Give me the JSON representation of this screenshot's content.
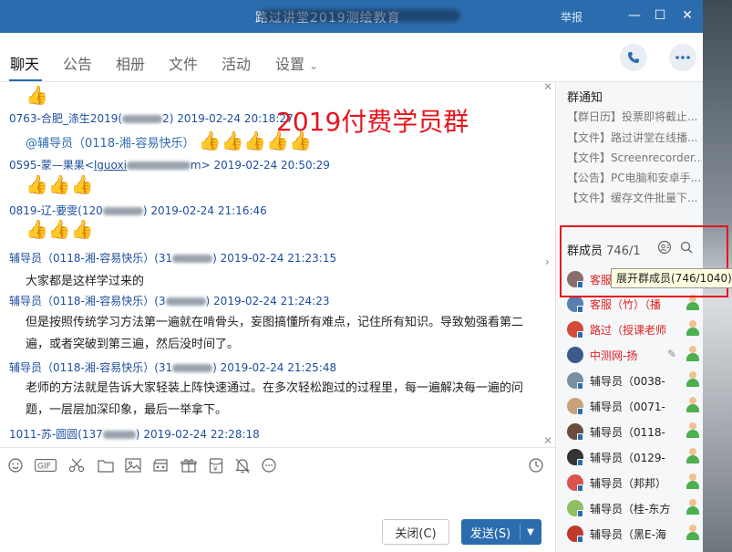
{
  "window": {
    "title": "路过讲堂2019测绘教育",
    "report_label": "举报",
    "minimize_glyph": "—",
    "maximize_glyph": "☐",
    "close_glyph": "✕"
  },
  "tabs": [
    {
      "label": "聊天",
      "active": true
    },
    {
      "label": "公告",
      "active": false
    },
    {
      "label": "相册",
      "active": false
    },
    {
      "label": "文件",
      "active": false
    },
    {
      "label": "活动",
      "active": false
    },
    {
      "label": "设置",
      "active": false
    }
  ],
  "settings_caret": "⌄",
  "messages": [
    {
      "thumbs": "👍"
    },
    {
      "sender": "0763-合肥_涤生2019(",
      "qq_tail": "2)",
      "time": "2019-02-24 20:18:27"
    },
    {
      "mention": "@辅导员（0118-湘-容易快乐）",
      "thumbs": "👍👍👍👍👍"
    },
    {
      "sender": "0595-蒙—果果<",
      "email_start": "lguoxi",
      "email_end": "m>",
      "time": "2019-02-24 20:50:29"
    },
    {
      "thumbs": "👍👍👍"
    },
    {
      "sender": "0819-辽-要雯(120",
      "qq_tail": ")",
      "time": "2019-02-24 21:16:46"
    },
    {
      "thumbs": "👍👍👍"
    },
    {
      "sender": "辅导员（0118-湘-容易快乐）(31",
      "qq_tail": ")",
      "time": "2019-02-24 21:23:15"
    },
    {
      "text": "大家都是这样学过来的"
    },
    {
      "sender": "辅导员（0118-湘-容易快乐）(3",
      "qq_tail": ")",
      "time": "2019-02-24 21:24:23"
    },
    {
      "text": "但是按照传统学习方法第一遍就在啃骨头，妄图搞懂所有难点，记住所有知识。导致勉强看第二遍，或者突破到第三遍，然后没时间了。"
    },
    {
      "sender": "辅导员（0118-湘-容易快乐）(31",
      "qq_tail": ")",
      "time": "2019-02-24 21:25:48"
    },
    {
      "text": "老师的方法就是告诉大家轻装上阵快速通过。在多次轻松跑过的过程里，每一遍解决每一遍的问题，一层层加深印象，最后一举拿下。"
    },
    {
      "sender": "1011-苏-圆圆(137",
      "qq_tail": ")",
      "time": "2019-02-24 22:28:18"
    }
  ],
  "overlay_label": "2019付费学员群",
  "toolbar_icons": [
    "smile-icon",
    "gif-icon",
    "scissors-icon",
    "folder-icon",
    "image-icon",
    "video-icon",
    "gift-icon",
    "red-envelope-icon",
    "bell-off-icon",
    "more-icon",
    "history-icon"
  ],
  "buttons": {
    "close": "关闭(C)",
    "send": "发送(S)"
  },
  "notice": {
    "title": "群通知",
    "items": [
      "【群日历】投票即将截止...",
      "【文件】路过讲堂在线播...",
      "【文件】Screenrecorder...",
      "【公告】PC电脑和安卓手...",
      "【文件】缓存文件批量下..."
    ]
  },
  "members": {
    "header": "群成员",
    "count": "746/1",
    "tooltip": "展开群成员(746/1040)",
    "list": [
      {
        "name": "客服",
        "color": "#e02020",
        "avatar": "#8a6d6d"
      },
      {
        "name": "客服（竹）（播",
        "color": "#e02020",
        "avatar": "#5a7fb0"
      },
      {
        "name": "路过（授课老师",
        "color": "#e02020",
        "avatar": "#d44a3a"
      },
      {
        "name": "中测网-扬",
        "color": "#e02020",
        "avatar": "#3c5a8c"
      },
      {
        "name": "辅导员（0038-",
        "color": "#222222",
        "avatar": "#7a8f9e"
      },
      {
        "name": "辅导员（0071-",
        "color": "#222222",
        "avatar": "#c9a07a"
      },
      {
        "name": "辅导员（0118-",
        "color": "#222222",
        "avatar": "#6b4d3d"
      },
      {
        "name": "辅导员（0129-",
        "color": "#222222",
        "avatar": "#333333"
      },
      {
        "name": "辅导员（邦邦）",
        "color": "#222222",
        "avatar": "#d9534f"
      },
      {
        "name": "辅导员（桂-东方",
        "color": "#222222",
        "avatar": "#8fbf60"
      },
      {
        "name": "辅导员（黑E-海",
        "color": "#222222",
        "avatar": "#c0392b"
      }
    ]
  }
}
